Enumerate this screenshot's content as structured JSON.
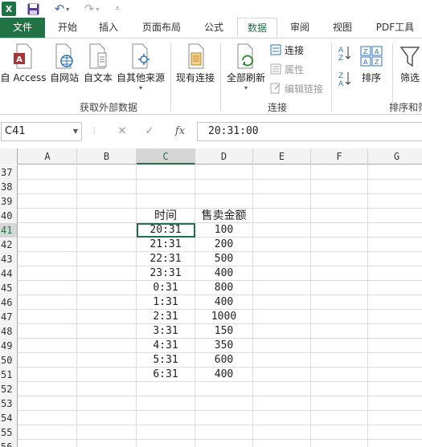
{
  "titlebar": {
    "app_icon": "X"
  },
  "tabs": [
    {
      "label": "文件"
    },
    {
      "label": "开始"
    },
    {
      "label": "插入"
    },
    {
      "label": "页面布局"
    },
    {
      "label": "公式"
    },
    {
      "label": "数据"
    },
    {
      "label": "审阅"
    },
    {
      "label": "视图"
    },
    {
      "label": "PDF工具"
    }
  ],
  "ribbon": {
    "access_label": "自 Access",
    "web_label": "自网站",
    "text_label": "自文本",
    "other_label": "自其他来源",
    "existing_label": "现有连接",
    "refresh_label": "全部刷新",
    "connections_label": "连接",
    "properties_label": "属性",
    "edit_links_label": "编辑链接",
    "sort_label": "排序",
    "filter_label": "筛选",
    "group_external": "获取外部数据",
    "group_connections": "连接",
    "group_sort": "排序和筛"
  },
  "formula_bar": {
    "name_box": "C41",
    "fx_symbol": "fx",
    "formula": "20:31:00"
  },
  "grid": {
    "columns": [
      "A",
      "B",
      "C",
      "D",
      "E",
      "F",
      "G"
    ],
    "rows": [
      {
        "num": "37",
        "c": "",
        "d": ""
      },
      {
        "num": "38",
        "c": "",
        "d": ""
      },
      {
        "num": "39",
        "c": "",
        "d": ""
      },
      {
        "num": "40",
        "c": "时间",
        "d": "售卖金额"
      },
      {
        "num": "41",
        "c": "20:31",
        "d": "100"
      },
      {
        "num": "42",
        "c": "21:31",
        "d": "200"
      },
      {
        "num": "43",
        "c": "22:31",
        "d": "500"
      },
      {
        "num": "44",
        "c": "23:31",
        "d": "400"
      },
      {
        "num": "45",
        "c": "0:31",
        "d": "800"
      },
      {
        "num": "46",
        "c": "1:31",
        "d": "400"
      },
      {
        "num": "47",
        "c": "2:31",
        "d": "1000"
      },
      {
        "num": "48",
        "c": "3:31",
        "d": "150"
      },
      {
        "num": "49",
        "c": "4:31",
        "d": "350"
      },
      {
        "num": "50",
        "c": "5:31",
        "d": "600"
      },
      {
        "num": "51",
        "c": "6:31",
        "d": "400"
      },
      {
        "num": "52",
        "c": "",
        "d": ""
      },
      {
        "num": "53",
        "c": "",
        "d": ""
      },
      {
        "num": "54",
        "c": "",
        "d": ""
      },
      {
        "num": "55",
        "c": "",
        "d": ""
      },
      {
        "num": "56",
        "c": "",
        "d": ""
      }
    ]
  },
  "colors": {
    "accent": "#217346"
  }
}
